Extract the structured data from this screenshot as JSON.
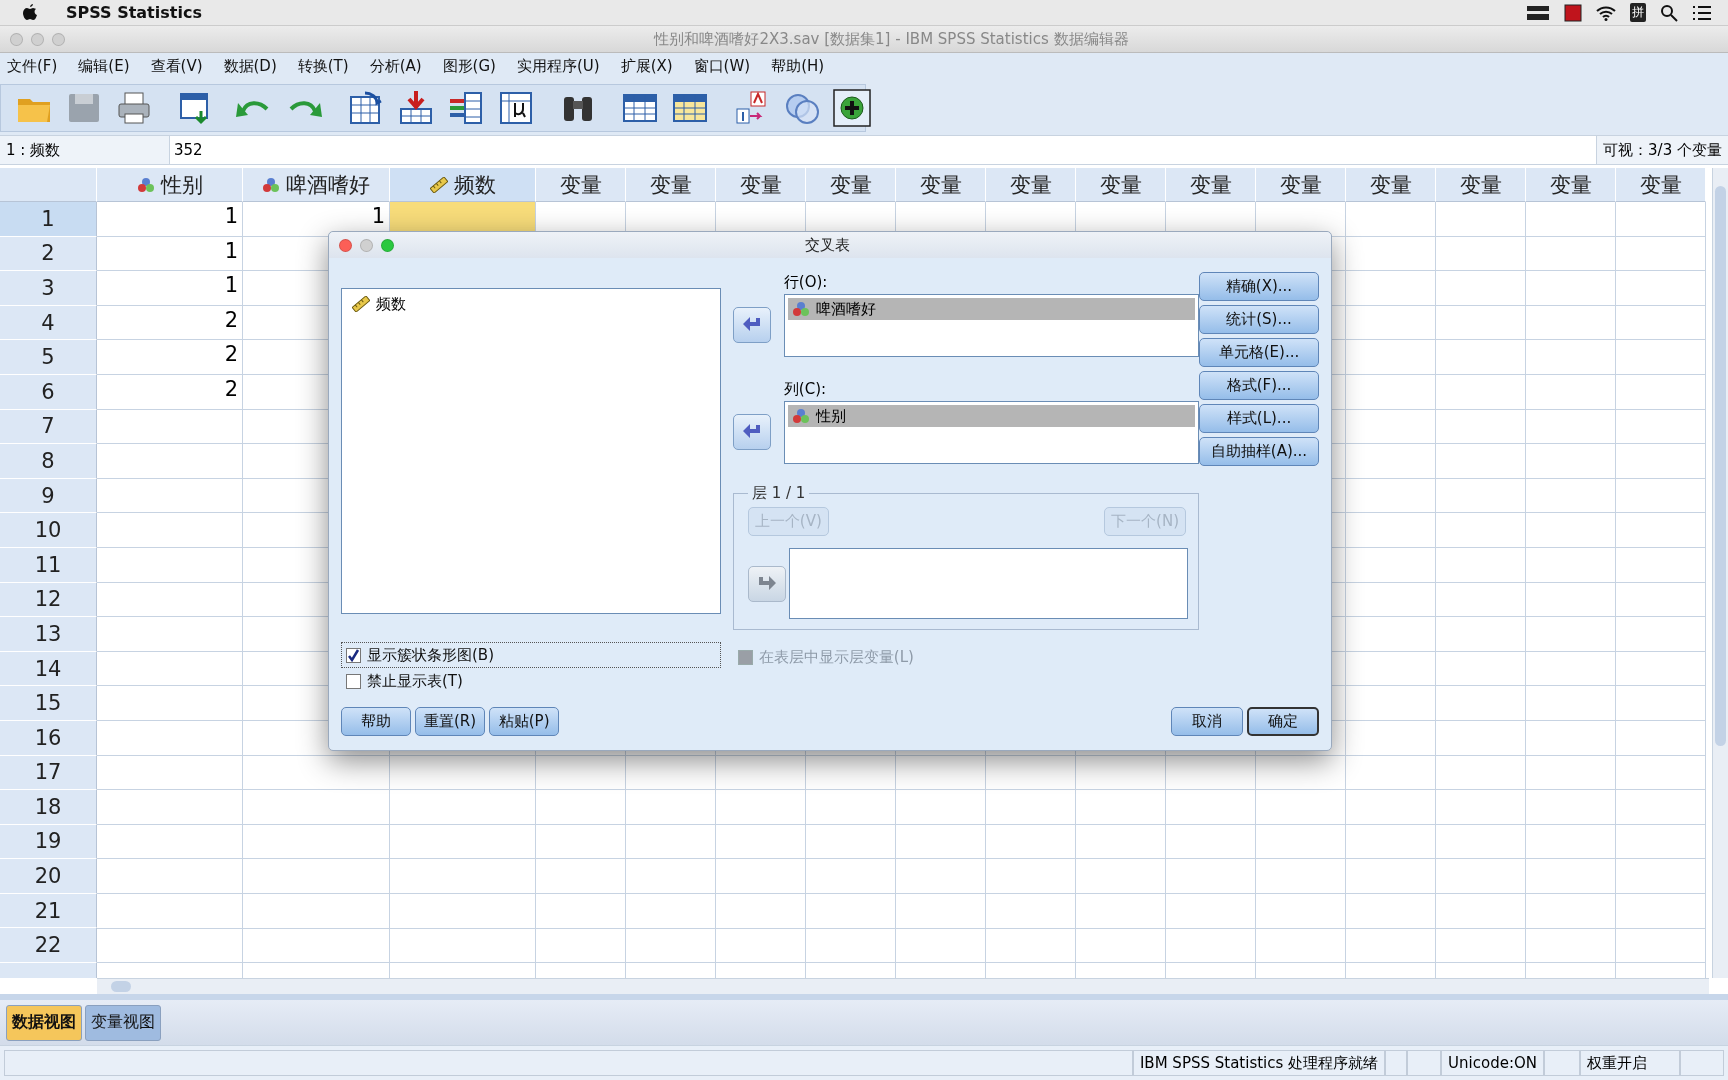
{
  "system_bar": {
    "app": "SPSS Statistics",
    "input_method": "拼"
  },
  "window": {
    "title": "性别和啤酒嗜好2X3.sav [数据集1] - IBM SPSS Statistics 数据编辑器"
  },
  "menu": [
    "文件(F)",
    "编辑(E)",
    "查看(V)",
    "数据(D)",
    "转换(T)",
    "分析(A)",
    "图形(G)",
    "实用程序(U)",
    "扩展(X)",
    "窗口(W)",
    "帮助(H)"
  ],
  "cell_bar": {
    "cell": "1 : 频数",
    "value": "352",
    "visible": "可视：3/3 个变量"
  },
  "grid": {
    "columns": [
      {
        "label": "性别",
        "kind": "nominal",
        "active": false
      },
      {
        "label": "啤酒嗜好",
        "kind": "nominal",
        "active": false
      },
      {
        "label": "频数",
        "kind": "scale",
        "active": true
      },
      {
        "label": "变量",
        "kind": "empty",
        "active": false
      },
      {
        "label": "变量",
        "kind": "empty",
        "active": false
      },
      {
        "label": "变量",
        "kind": "empty",
        "active": false
      },
      {
        "label": "变量",
        "kind": "empty",
        "active": false
      },
      {
        "label": "变量",
        "kind": "empty",
        "active": false
      },
      {
        "label": "变量",
        "kind": "empty",
        "active": false
      },
      {
        "label": "变量",
        "kind": "empty",
        "active": false
      },
      {
        "label": "变量",
        "kind": "empty",
        "active": false
      },
      {
        "label": "变量",
        "kind": "empty",
        "active": false
      },
      {
        "label": "变量",
        "kind": "empty",
        "active": false
      },
      {
        "label": "变量",
        "kind": "empty",
        "active": false
      },
      {
        "label": "变量",
        "kind": "empty",
        "active": false
      },
      {
        "label": "变量",
        "kind": "empty",
        "active": false
      }
    ],
    "rows": [
      {
        "number": "1",
        "active": true,
        "cells": [
          "1",
          "1"
        ]
      },
      {
        "number": "2",
        "active": false,
        "cells": [
          "1"
        ]
      },
      {
        "number": "3",
        "active": false,
        "cells": [
          "1"
        ]
      },
      {
        "number": "4",
        "active": false,
        "cells": [
          "2"
        ]
      },
      {
        "number": "5",
        "active": false,
        "cells": [
          "2"
        ]
      },
      {
        "number": "6",
        "active": false,
        "cells": [
          "2"
        ]
      },
      {
        "number": "7",
        "active": false,
        "cells": []
      },
      {
        "number": "8",
        "active": false,
        "cells": []
      },
      {
        "number": "9",
        "active": false,
        "cells": []
      },
      {
        "number": "10",
        "active": false,
        "cells": []
      },
      {
        "number": "11",
        "active": false,
        "cells": []
      },
      {
        "number": "12",
        "active": false,
        "cells": []
      },
      {
        "number": "13",
        "active": false,
        "cells": []
      },
      {
        "number": "14",
        "active": false,
        "cells": []
      },
      {
        "number": "15",
        "active": false,
        "cells": []
      },
      {
        "number": "16",
        "active": false,
        "cells": []
      },
      {
        "number": "17",
        "active": false,
        "cells": []
      },
      {
        "number": "18",
        "active": false,
        "cells": []
      },
      {
        "number": "19",
        "active": false,
        "cells": []
      },
      {
        "number": "20",
        "active": false,
        "cells": []
      },
      {
        "number": "21",
        "active": false,
        "cells": []
      },
      {
        "number": "22",
        "active": false,
        "cells": []
      }
    ]
  },
  "dialog": {
    "title": "交叉表",
    "source_list": [
      {
        "label": "频数",
        "kind": "scale"
      }
    ],
    "row_box": {
      "label": "行(O):",
      "items": [
        {
          "label": "啤酒嗜好",
          "kind": "nominal",
          "selected": true
        }
      ]
    },
    "column_box": {
      "label": "列(C):",
      "items": [
        {
          "label": "性别",
          "kind": "nominal",
          "selected": true
        }
      ]
    },
    "layer": {
      "label": "层 1 / 1",
      "previous": {
        "label": "上一个(V)",
        "disabled": true
      },
      "next": {
        "label": "下一个(N)",
        "disabled": true
      }
    },
    "layer_option": {
      "label": "在表层中显示层变量(L)",
      "checked": false,
      "disabled": true
    },
    "side_buttons": [
      "精确(X)...",
      "统计(S)...",
      "单元格(E)...",
      "格式(F)...",
      "样式(L)...",
      "自助抽样(A)..."
    ],
    "checkboxes": [
      {
        "label": "显示簇状条形图(B)",
        "checked": true,
        "focused": true
      },
      {
        "label": "禁止显示表(T)",
        "checked": false,
        "focused": false
      }
    ],
    "left_buttons": [
      "帮助",
      "重置(R)",
      "粘贴(P)"
    ],
    "right_buttons": [
      {
        "label": "取消",
        "default": false
      },
      {
        "label": "确定",
        "default": true
      }
    ]
  },
  "view_tabs": [
    {
      "label": "数据视图",
      "selected": true
    },
    {
      "label": "变量视图",
      "selected": false
    }
  ],
  "status_bar": [
    "IBM SPSS Statistics 处理程序就绪",
    "Unicode:ON",
    "权重开启"
  ]
}
